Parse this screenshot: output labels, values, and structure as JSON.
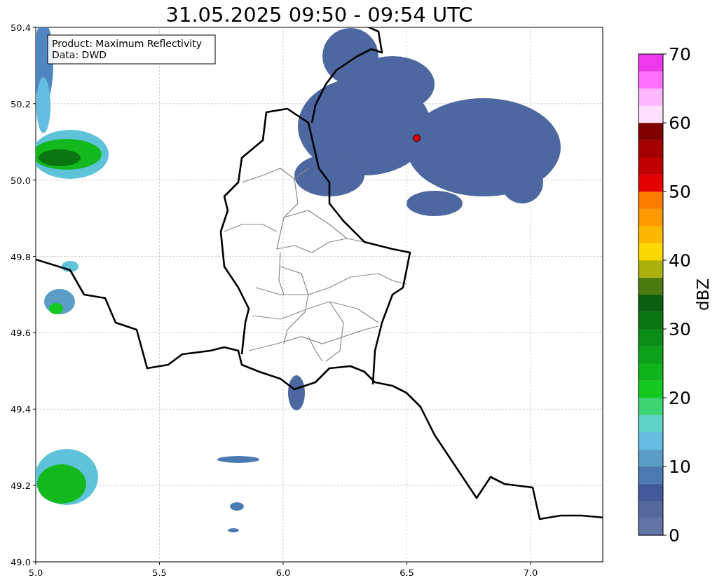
{
  "title": "31.05.2025 09:50 - 09:54 UTC",
  "map": {
    "annotation": [
      "Product: Maximum Reflectivity",
      "Data: DWD"
    ],
    "xticks": [
      "5.0",
      "5.5",
      "6.0",
      "6.5",
      "7.0"
    ],
    "yticks": [
      "50.4",
      "50.2",
      "50.0",
      "49.8",
      "49.6",
      "49.4",
      "49.2",
      "49.0"
    ]
  },
  "colorbar": {
    "label": "dBZ",
    "ticks": [
      "70",
      "60",
      "50",
      "40",
      "30",
      "20",
      "10",
      "0"
    ],
    "segments": [
      {
        "color": "#6374a6"
      },
      {
        "color": "#55689e"
      },
      {
        "color": "#44599c"
      },
      {
        "color": "#4b79b2"
      },
      {
        "color": "#5a9ec8"
      },
      {
        "color": "#63bde0"
      },
      {
        "color": "#5ed4c8"
      },
      {
        "color": "#3dd473"
      },
      {
        "color": "#14c820"
      },
      {
        "color": "#0fb31a"
      },
      {
        "color": "#0da01a"
      },
      {
        "color": "#0b8c16"
      },
      {
        "color": "#0a7412"
      },
      {
        "color": "#0a5e10"
      },
      {
        "color": "#4a7a10"
      },
      {
        "color": "#aab00c"
      },
      {
        "color": "#fcd800"
      },
      {
        "color": "#fcb800"
      },
      {
        "color": "#fc9a00"
      },
      {
        "color": "#fc7c00"
      },
      {
        "color": "#e40000"
      },
      {
        "color": "#c00000"
      },
      {
        "color": "#a40000"
      },
      {
        "color": "#800000"
      },
      {
        "color": "#ffe0ff"
      },
      {
        "color": "#ffb8ff"
      },
      {
        "color": "#ff70ff"
      },
      {
        "color": "#ee38ee"
      }
    ]
  }
}
